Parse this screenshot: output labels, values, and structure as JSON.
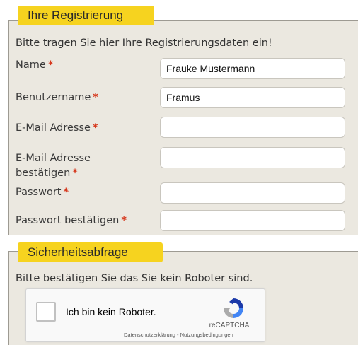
{
  "registration": {
    "legend": "Ihre Registrierung",
    "intro": "Bitte tragen Sie hier Ihre Registrierungsdaten ein!",
    "required_marker": "*",
    "fields": [
      {
        "label": "Name",
        "value": "Frauke Mustermann",
        "placeholder": ""
      },
      {
        "label": "Benutzername",
        "value": "Framus",
        "placeholder": ""
      },
      {
        "label": "E-Mail Adresse",
        "value": "",
        "placeholder": ""
      },
      {
        "label": "E-Mail Adresse bestätigen",
        "value": "",
        "placeholder": ""
      },
      {
        "label": "Passwort",
        "value": "",
        "placeholder": ""
      },
      {
        "label": "Passwort bestätigen",
        "value": "",
        "placeholder": ""
      }
    ]
  },
  "security": {
    "legend": "Sicherheitsabfrage",
    "intro": "Bitte bestätigen Sie das Sie kein Roboter sind.",
    "captcha": {
      "checkbox_label": "Ich bin kein Roboter.",
      "checked": false,
      "brand": "reCAPTCHA",
      "privacy_link": "Datenschutzerklärung",
      "separator": " - ",
      "terms_link": "Nutzungsbedingungen",
      "logo_icon": "recaptcha-logo-icon"
    }
  },
  "colors": {
    "legend_background": "#f6d31f",
    "panel_background": "#ebe8e0",
    "required_marker": "#d6371c"
  }
}
